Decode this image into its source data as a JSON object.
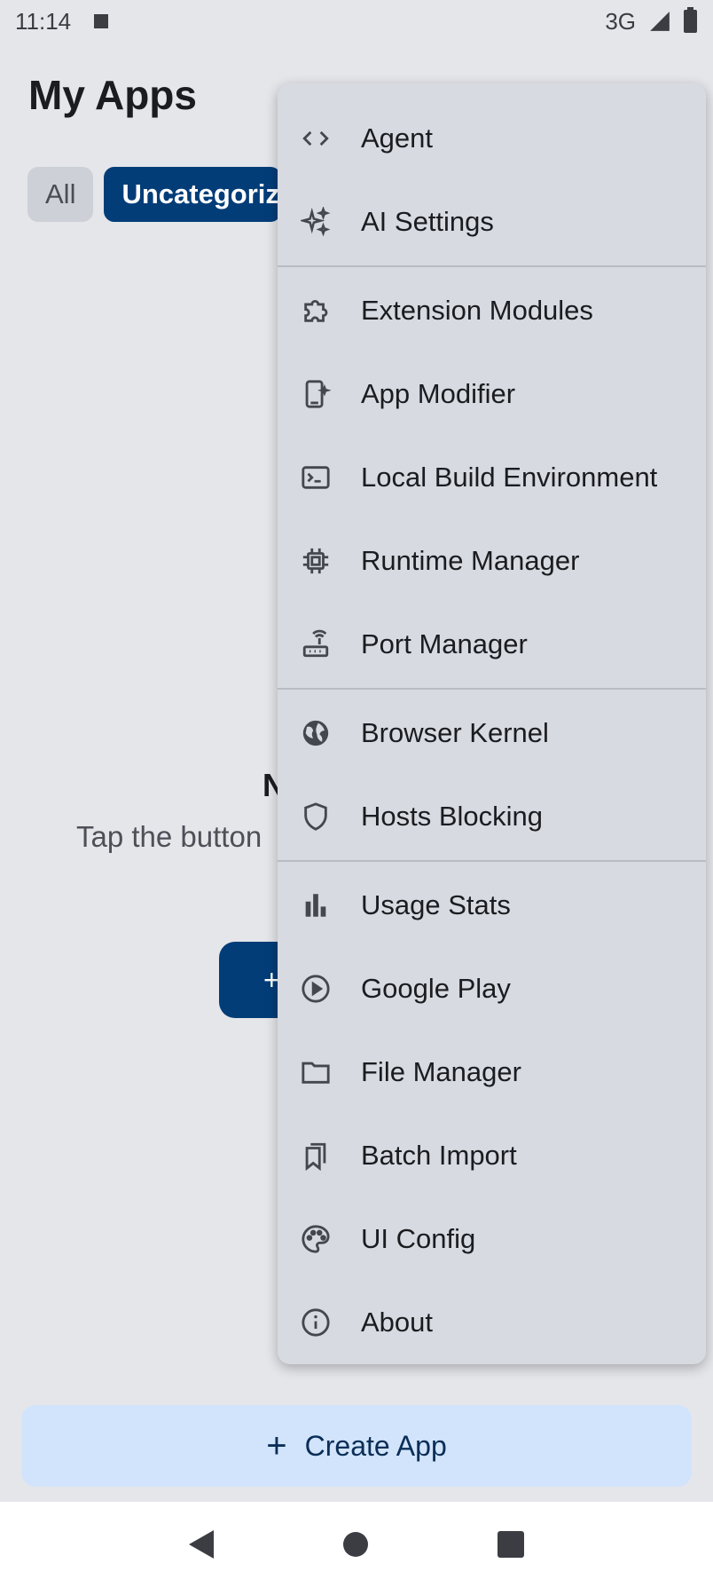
{
  "status_bar": {
    "time": "11:14",
    "network": "3G"
  },
  "header": {
    "title": "My Apps"
  },
  "chips": [
    {
      "label": "All"
    },
    {
      "label": "Uncategorized"
    }
  ],
  "empty_state": {
    "title": "N",
    "subtitle": "Tap the button",
    "button_label": "+"
  },
  "menu": {
    "items": [
      {
        "label": "Agent",
        "icon": "code-brackets-icon"
      },
      {
        "label": "AI Settings",
        "icon": "sparkle-icon"
      },
      {
        "label": "Extension Modules",
        "icon": "puzzle-icon"
      },
      {
        "label": "App Modifier",
        "icon": "phone-sparkle-icon"
      },
      {
        "label": "Local Build Environment",
        "icon": "terminal-icon"
      },
      {
        "label": "Runtime Manager",
        "icon": "chip-icon"
      },
      {
        "label": "Port Manager",
        "icon": "router-icon"
      },
      {
        "label": "Browser Kernel",
        "icon": "globe-icon"
      },
      {
        "label": "Hosts Blocking",
        "icon": "shield-icon"
      },
      {
        "label": "Usage Stats",
        "icon": "bar-chart-icon"
      },
      {
        "label": "Google Play",
        "icon": "play-circle-icon"
      },
      {
        "label": "File Manager",
        "icon": "folder-icon"
      },
      {
        "label": "Batch Import",
        "icon": "bookmarks-icon"
      },
      {
        "label": "UI Config",
        "icon": "palette-icon"
      },
      {
        "label": "About",
        "icon": "info-icon"
      }
    ]
  },
  "create_app": {
    "label": "Create App",
    "icon": "plus-icon"
  },
  "colors": {
    "primary": "#033d78",
    "background": "#e4e6ea",
    "menu_bg": "#d7dae1",
    "create_bg": "#d2e4fb"
  }
}
